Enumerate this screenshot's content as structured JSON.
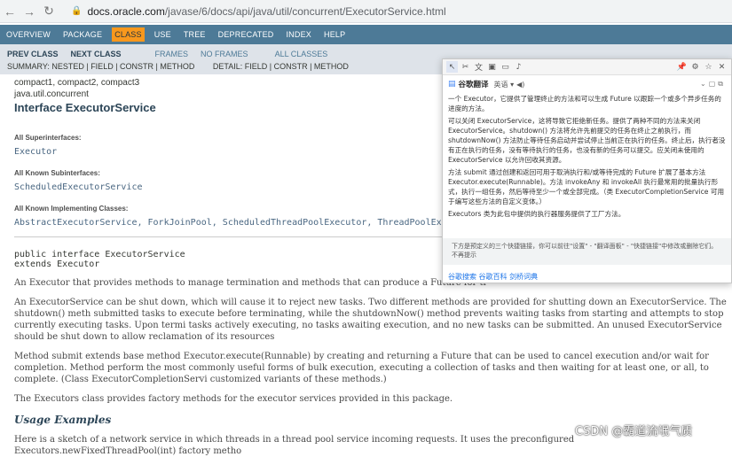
{
  "browser": {
    "url_domain": "docs.oracle.com",
    "url_path": "/javase/6/docs/api/java/util/concurrent/ExecutorService.html"
  },
  "topnav": [
    "OVERVIEW",
    "PACKAGE",
    "CLASS",
    "USE",
    "TREE",
    "DEPRECATED",
    "INDEX",
    "HELP"
  ],
  "subnav": {
    "prev": "PREV CLASS",
    "next": "NEXT CLASS",
    "frames": "FRAMES",
    "noframes": "NO FRAMES",
    "allclasses": "ALL CLASSES",
    "summary": "SUMMARY: NESTED | FIELD | CONSTR | METHOD",
    "detail": "DETAIL: FIELD | CONSTR | METHOD"
  },
  "doc": {
    "profiles": "compact1, compact2, compact3",
    "package": "java.util.concurrent",
    "title": "Interface ExecutorService",
    "superinterfaces_label": "All Superinterfaces:",
    "superinterfaces": "Executor",
    "subinterfaces_label": "All Known Subinterfaces:",
    "subinterfaces": "ScheduledExecutorService",
    "impl_label": "All Known Implementing Classes:",
    "impl_classes": "AbstractExecutorService, ForkJoinPool, ScheduledThreadPoolExecutor, ThreadPoolExecutor",
    "sig_line1": "public interface ExecutorService",
    "sig_line2": "extends Executor",
    "para1": "An Executor that provides methods to manage termination and methods that can produce a Future for tr",
    "para2": "An ExecutorService can be shut down, which will cause it to reject new tasks. Two different methods are provided for shutting down an ExecutorService. The shutdown() meth submitted tasks to execute before terminating, while the shutdownNow() method prevents waiting tasks from starting and attempts to stop currently executing tasks. Upon termi tasks actively executing, no tasks awaiting execution, and no new tasks can be submitted. An unused ExecutorService should be shut down to allow reclamation of its resources",
    "para3": "Method submit extends base method Executor.execute(Runnable) by creating and returning a Future that can be used to cancel execution and/or wait for completion. Method perform the most commonly useful forms of bulk execution, executing a collection of tasks and then waiting for at least one, or all, to complete. (Class ExecutorCompletionServi customized variants of these methods.)",
    "para4": "The Executors class provides factory methods for the executor services provided in this package.",
    "usage_heading": "Usage Examples",
    "para5": "Here is a sketch of a network service in which threads in a thread pool service incoming requests. It uses the preconfigured Executors.newFixedThreadPool(int) factory metho"
  },
  "translator": {
    "name": "谷歌翻译",
    "lang": "英语 ▾",
    "p1": "一个 Executor，它提供了管理终止的方法和可以生成 Future 以跟踪一个或多个异步任务的进度的方法。",
    "p2": "可以关闭 ExecutorService，这将导致它拒绝新任务。提供了两种不同的方法来关闭 ExecutorService。shutdown() 方法将允许先前提交的任务在终止之前执行，而 shutdownNow() 方法防止等待任务启动并尝试停止当前正在执行的任务。终止后，执行者没有正在执行的任务，没有等待执行的任务，也没有新的任务可以提交。应关闭未使用的 ExecutorService 以允许回收其资源。",
    "p3": "方法 submit 通过创建和返回可用于取消执行和/或等待完成的 Future 扩展了基本方法 Executor.execute(Runnable)。方法 invokeAny 和 invokeAll 执行最常用的批量执行形式，执行一组任务，然后等待至少一个或全部完成。（类 ExecutorCompletionService 可用于编写这些方法的自定义变体。）",
    "p4": "Executors 类为此包中提供的执行器服务提供了工厂方法。",
    "footer": "下方是预定义的三个快捷链接，你可以前往\"设置\" - \"翻译面板\" - \"快捷链接\"中修改或删除它们。不再提示",
    "links": "谷歌搜索  谷歌百科  剑桥词典"
  },
  "watermark": "CSDN @霸道流氓气质"
}
